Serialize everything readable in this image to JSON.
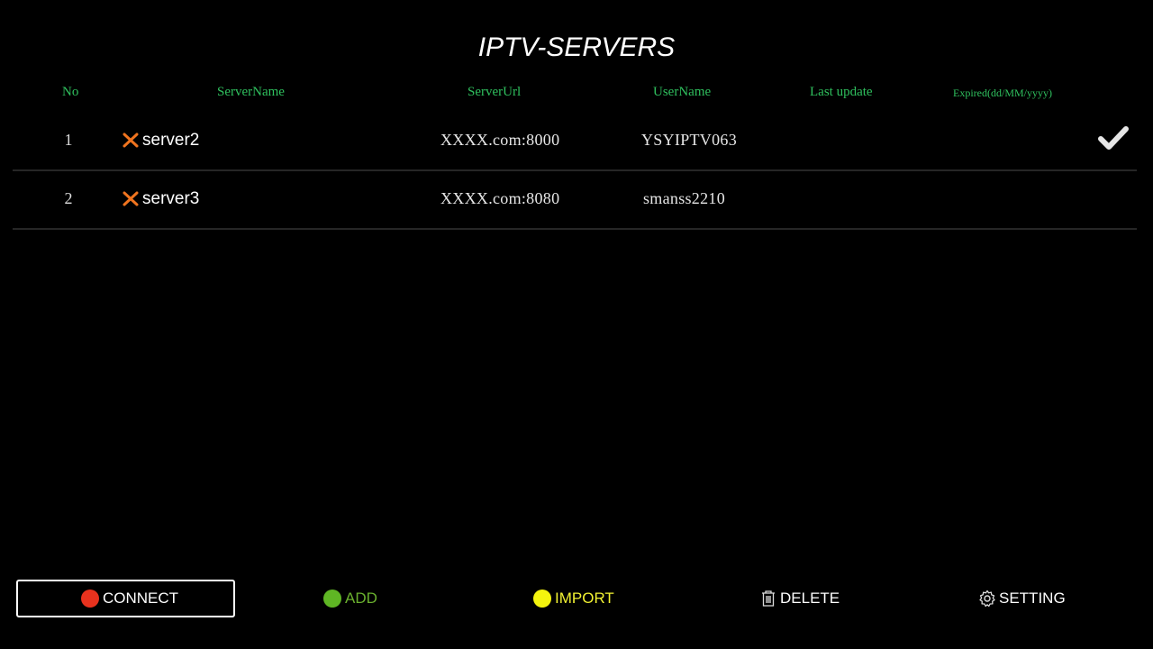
{
  "title": "IPTV-SERVERS",
  "columns": {
    "no": "No",
    "server_name": "ServerName",
    "server_url": "ServerUrl",
    "user_name": "UserName",
    "last_update": "Last update",
    "expired": "Expired(dd/MM/yyyy)"
  },
  "rows": [
    {
      "no": "1",
      "name": "server2",
      "url": "XXXX.com:8000",
      "user": "YSYIPTV063",
      "last_update": "",
      "expired": "",
      "selected": true,
      "icon": "close-x-icon"
    },
    {
      "no": "2",
      "name": "server3",
      "url": "XXXX.com:8080",
      "user": "smanss2210",
      "last_update": "",
      "expired": "",
      "selected": false,
      "icon": "close-x-icon"
    }
  ],
  "actions": {
    "connect": "CONNECT",
    "add": "ADD",
    "import": "IMPORT",
    "delete": "DELETE",
    "setting": "SETTING"
  },
  "colors": {
    "header": "#2fc05e",
    "connect_dot": "#e8321e",
    "add_dot": "#5fb624",
    "add_text": "#6ab02e",
    "import_dot": "#f4f40e",
    "import_text": "#f2f232",
    "x_icon": "#f0741f"
  }
}
